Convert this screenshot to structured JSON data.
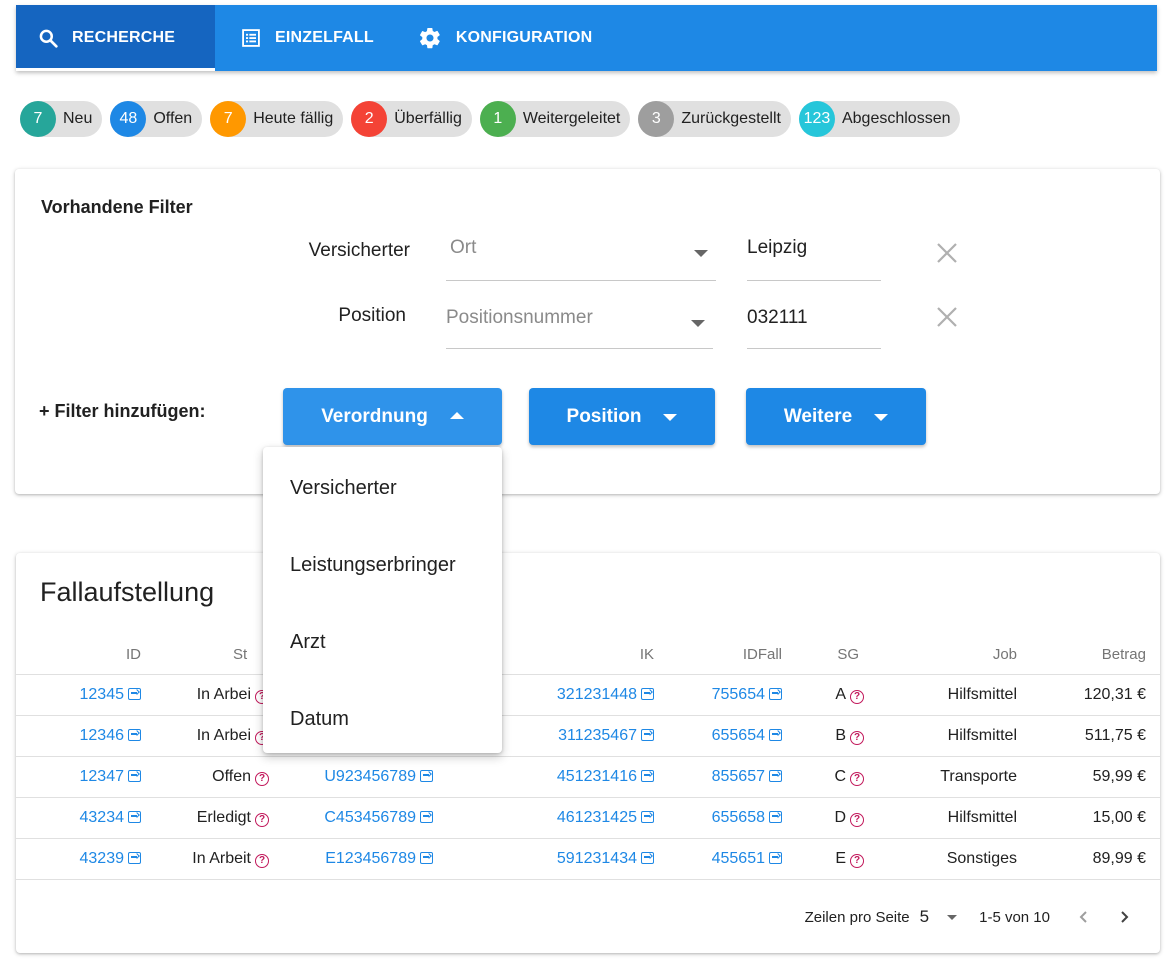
{
  "nav": {
    "tabs": [
      {
        "label": "RECHERCHE",
        "icon": "search-icon",
        "active": true
      },
      {
        "label": "EINZELFALL",
        "icon": "list-icon",
        "active": false
      },
      {
        "label": "KONFIGURATION",
        "icon": "gear-icon",
        "active": false
      }
    ]
  },
  "chips": [
    {
      "count": "7",
      "label": "Neu",
      "color": "#26a69a"
    },
    {
      "count": "48",
      "label": "Offen",
      "color": "#1e88e5"
    },
    {
      "count": "7",
      "label": "Heute fällig",
      "color": "#ff9800"
    },
    {
      "count": "2",
      "label": "Überfällig",
      "color": "#f44336"
    },
    {
      "count": "1",
      "label": "Weitergeleitet",
      "color": "#4caf50"
    },
    {
      "count": "3",
      "label": "Zurückgestellt",
      "color": "#9e9e9e"
    },
    {
      "count": "123",
      "label": "Abgeschlossen",
      "color": "#26c6da"
    }
  ],
  "filters": {
    "heading": "Vorhandene Filter",
    "rows": [
      {
        "category": "Versicherter",
        "field": "Ort",
        "value": "Leipzig"
      },
      {
        "category": "Position",
        "field": "Positionsnummer",
        "value": "032111"
      }
    ],
    "add_label": "+ Filter hinzufügen:",
    "buttons": [
      {
        "label": "Verordnung",
        "open": true
      },
      {
        "label": "Position",
        "open": false
      },
      {
        "label": "Weitere",
        "open": false
      }
    ]
  },
  "dropdown_menu": {
    "items": [
      "Versicherter",
      "Leistungserbringer",
      "Arzt",
      "Datum"
    ]
  },
  "table": {
    "title": "Fallaufstellung",
    "headers": [
      "ID",
      "St",
      "",
      "IK",
      "IDFall",
      "SG",
      "Job",
      "Betrag"
    ],
    "rows": [
      {
        "id": "12345",
        "status": "In Arbei",
        "vnr": "",
        "ik": "321231448",
        "idfall": "755654",
        "sg": "A",
        "job": "Hilfsmittel",
        "betrag": "120,31 €"
      },
      {
        "id": "12346",
        "status": "In Arbei",
        "vnr": "",
        "ik": "311235467",
        "idfall": "655654",
        "sg": "B",
        "job": "Hilfsmittel",
        "betrag": "511,75 €"
      },
      {
        "id": "12347",
        "status": "Offen",
        "vnr": "U923456789",
        "ik": "451231416",
        "idfall": "855657",
        "sg": "C",
        "job": "Transporte",
        "betrag": "59,99 €"
      },
      {
        "id": "43234",
        "status": "Erledigt",
        "vnr": "C453456789",
        "ik": "461231425",
        "idfall": "655658",
        "sg": "D",
        "job": "Hilfsmittel",
        "betrag": "15,00 €"
      },
      {
        "id": "43239",
        "status": "In Arbeit",
        "vnr": "E123456789",
        "ik": "591231434",
        "idfall": "455651",
        "sg": "E",
        "job": "Sonstiges",
        "betrag": "89,99 €"
      }
    ],
    "pager": {
      "rows_label": "Zeilen pro Seite",
      "rows_value": "5",
      "range": "1-5 von 10"
    }
  }
}
